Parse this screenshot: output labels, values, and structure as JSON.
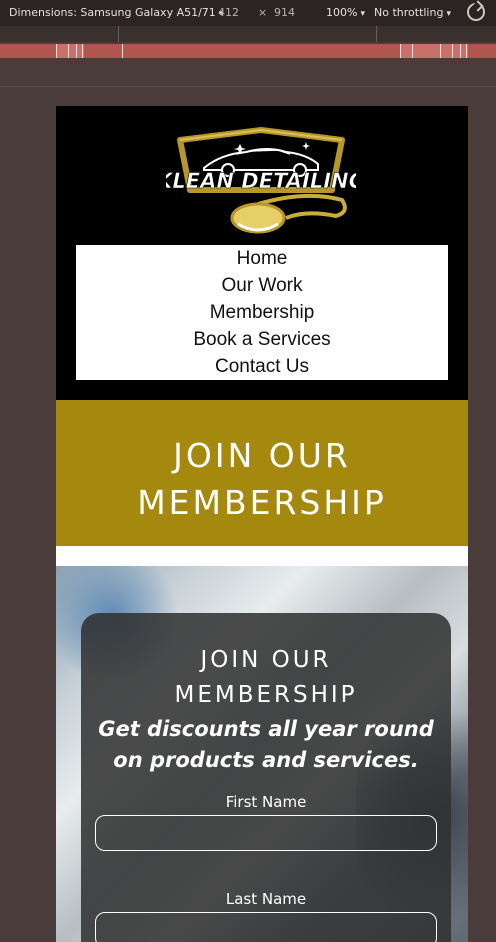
{
  "devtools": {
    "dimensions_label": "Dimensions: Samsung Galaxy A51/71",
    "width": "412",
    "times": "×",
    "height": "914",
    "zoom": "100%",
    "throttling": "No throttling",
    "caret": "▾",
    "rotate_icon": "rotate-icon"
  },
  "site": {
    "logo_text": "KLEAN DETAILING",
    "nav": [
      "Home",
      "Our Work",
      "Membership",
      "Book a Services",
      "Contact Us"
    ],
    "banner": {
      "line1": "JOIN OUR",
      "line2": "MEMBERSHIP"
    },
    "form": {
      "title_line1": "JOIN OUR",
      "title_line2": "MEMBERSHIP",
      "subtitle": "Get discounts all year round on products and services.",
      "first_name_label": "First Name",
      "first_name_value": "",
      "last_name_label": "Last Name",
      "last_name_value": ""
    }
  },
  "colors": {
    "banner": "#a5890e",
    "header": "#000000",
    "logo_gold": "#b8972a"
  }
}
